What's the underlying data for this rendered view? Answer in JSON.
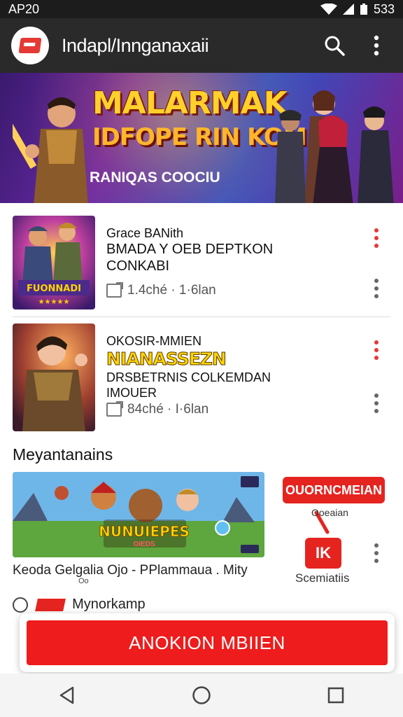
{
  "status": {
    "time": "AP20",
    "battery": "533"
  },
  "appbar": {
    "title": "Indapl/Innganaxaii",
    "icons": [
      "search-icon",
      "more-vert-icon"
    ]
  },
  "hero": {
    "title": "MALARMAK",
    "subtitle": "IDFOPE RIN KOM",
    "tag": "RANIQAS COOCIU"
  },
  "cards": [
    {
      "thumb_label": "FUONNADI",
      "line1": "Grace BANith",
      "line2": "BMADA Y OEB DEPTKON",
      "line3": "CONKABI",
      "meta": "1.4ché · 1·6lan"
    },
    {
      "line1": "OKOSIR-MMIEN",
      "line2": "NIANASSEZN",
      "line3": "DRSBETRNIS COLKEMDAN",
      "line4": "IMOUER",
      "meta": "84ché · I·6lan"
    }
  ],
  "section": {
    "title": "Meyantanains"
  },
  "promo": {
    "image_text": "NUNUIEPES",
    "image_subtext": "OIEDS",
    "caption": "Keoda Gelgalia Ojo - PPlammaua . Mity",
    "caption_sub": "Oo",
    "badge": "OUORNCMEIAN",
    "small_label": "Ooeaian",
    "logo_text": "IK",
    "logo_label": "Scemiatiis"
  },
  "peek": {
    "label": "Mynorkamp"
  },
  "cta": {
    "label": "ANOKION MBIIEN"
  },
  "navbar": {
    "icons": [
      "back-icon",
      "home-icon",
      "recents-icon"
    ]
  },
  "colors": {
    "accent": "#ee1c1c",
    "appbar": "#2a2a2a",
    "status": "#1c1c1c",
    "highlight_text": "#ffd400"
  }
}
